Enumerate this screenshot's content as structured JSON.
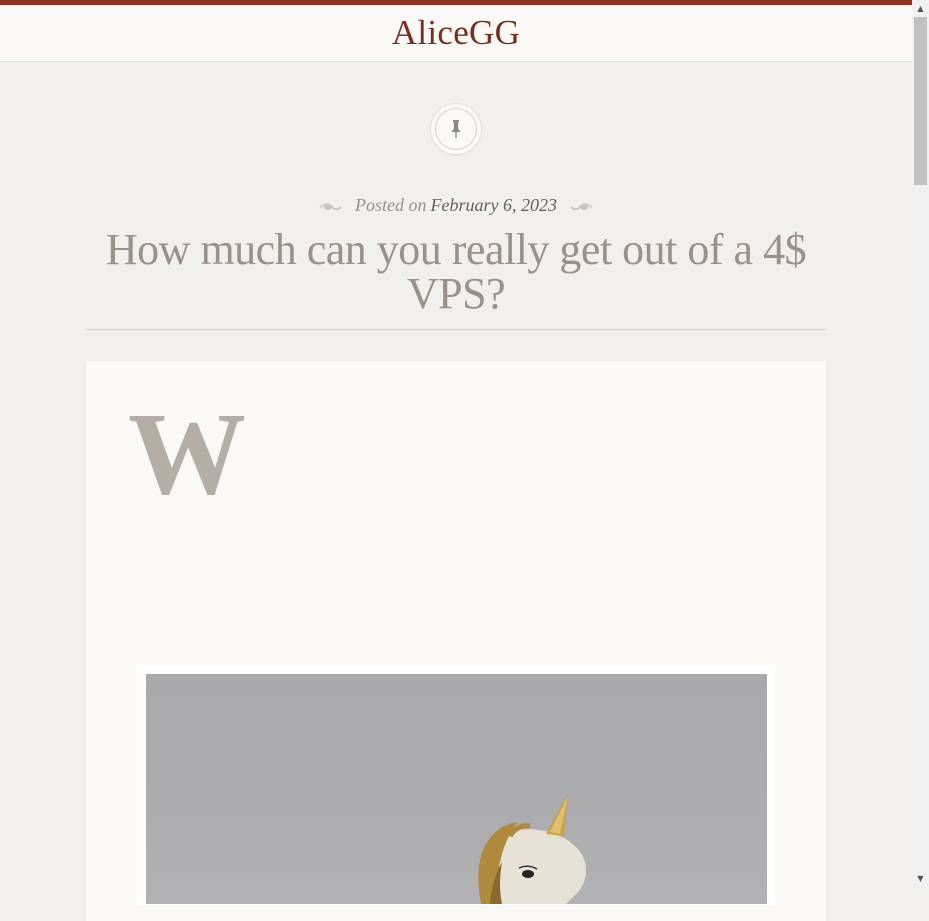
{
  "site": {
    "title": "AliceGG",
    "accent_color": "#8f3422"
  },
  "post": {
    "badge_icon": "pin-icon",
    "meta_prefix": "Posted on",
    "date": "February 6, 2023",
    "title": "How much can you really get out of a 4$ VPS?",
    "drop_cap": "W",
    "featured_image": "unicorn-figurine-photo"
  },
  "scrollbar": {
    "up_arrow": "▲",
    "down_arrow": "▼"
  }
}
